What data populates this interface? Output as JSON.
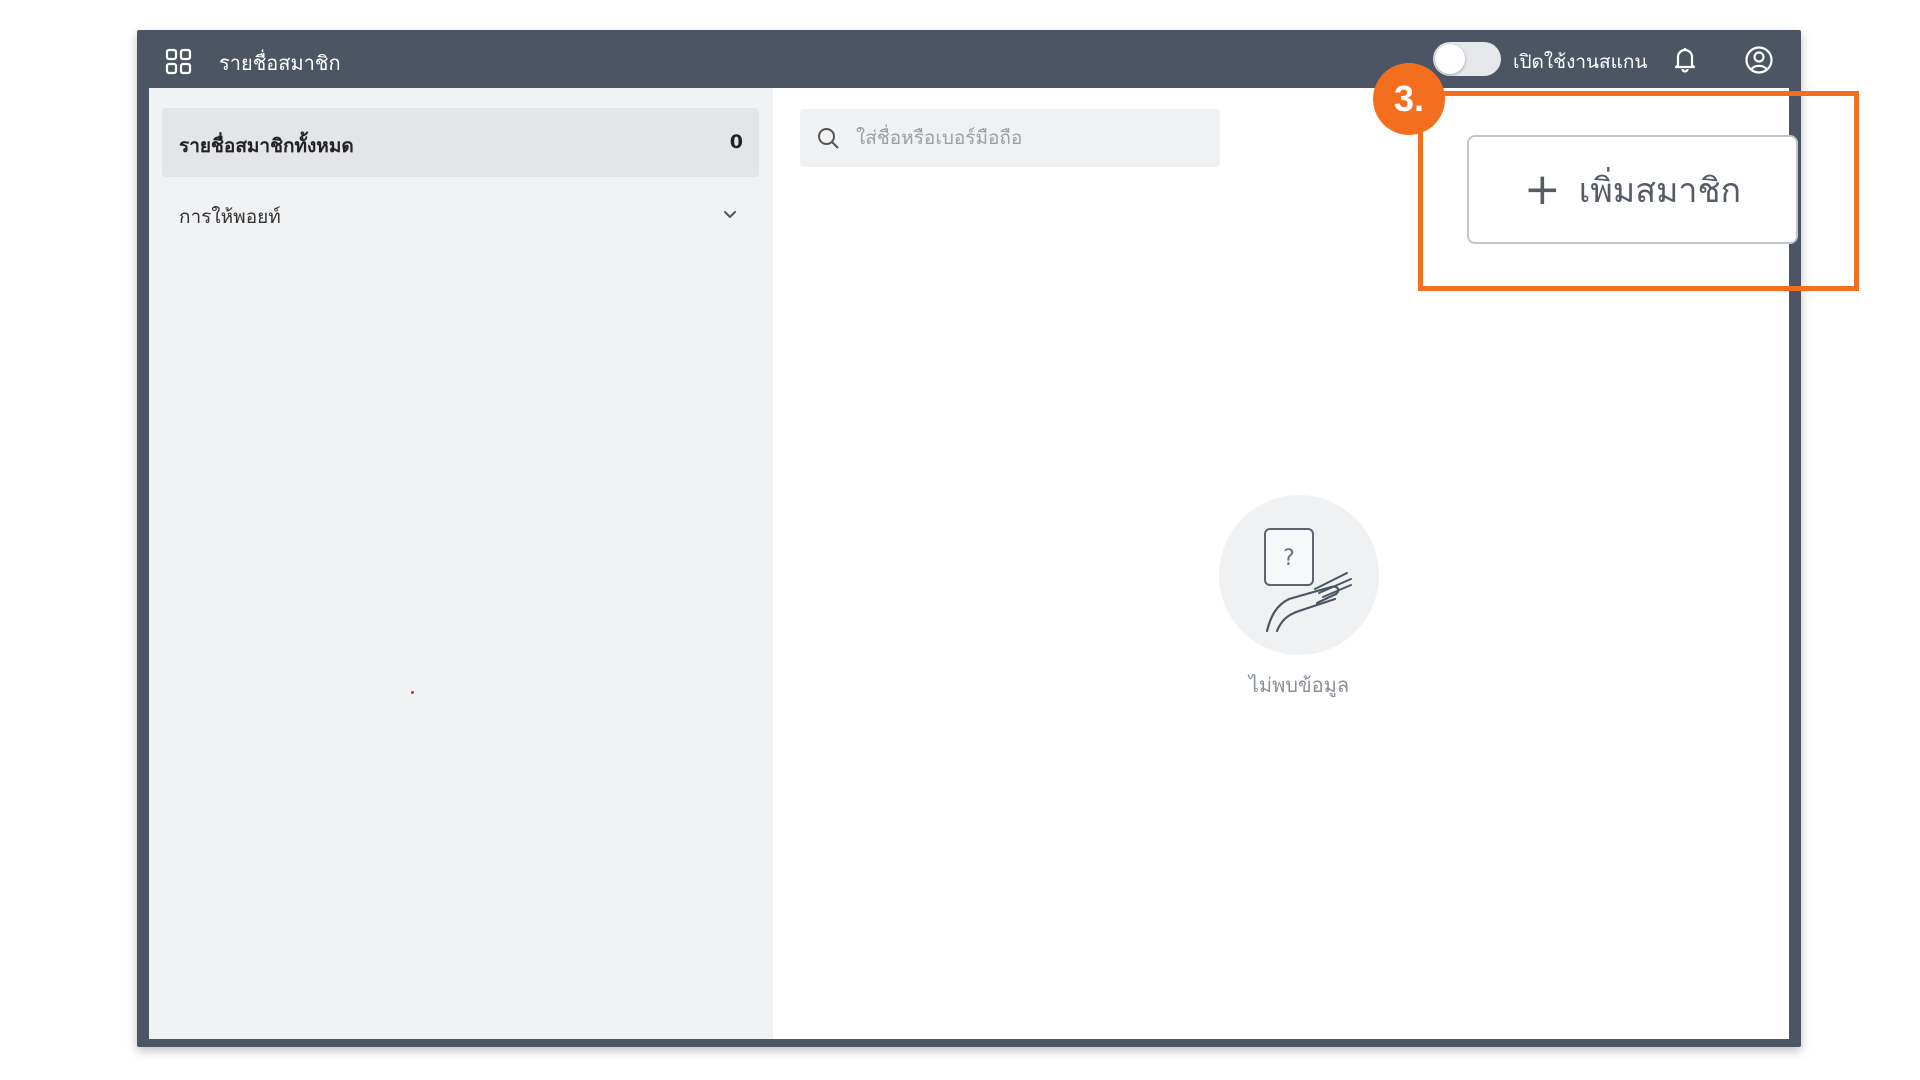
{
  "header": {
    "title": "รายชื่อสมาชิก",
    "scan_toggle_label": "เปิดใช้งานสแกน",
    "scan_toggle_on": false
  },
  "sidebar": {
    "items": [
      {
        "label": "รายชื่อสมาชิกทั้งหมด",
        "count": "0",
        "active": true
      },
      {
        "label": "การให้พอยท์",
        "expandable": true
      }
    ]
  },
  "search": {
    "placeholder": "ใส่ชื่อหรือเบอร์มือถือ",
    "value": ""
  },
  "empty_state": {
    "message": "ไม่พบข้อมูล",
    "icon": "question-card-hand-icon"
  },
  "actions": {
    "add_member_label": "เพิ่มสมาชิก"
  },
  "annotation": {
    "step_label": "3.",
    "color": "#f36f1f"
  },
  "colors": {
    "header_bg": "#4c5563",
    "sidebar_bg": "#f1f2f4",
    "accent": "#f36f1f"
  }
}
